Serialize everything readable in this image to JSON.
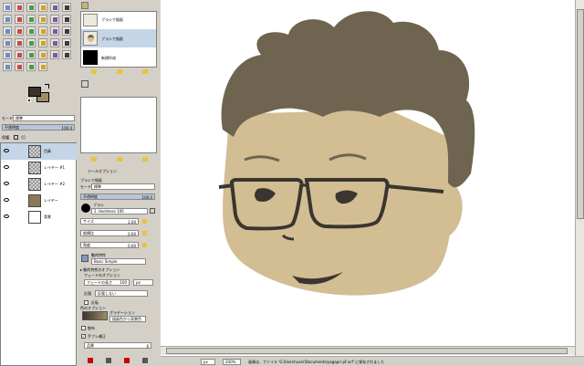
{
  "colors": {
    "hair": "#6f6450",
    "skin": "#d3bd93",
    "face_lines": "#3a352e",
    "canvas_bg": "#ffffff",
    "panel_bg": "#d4d0c8",
    "selection": "#c5d5e8",
    "fg_color": "#3b3228",
    "bg_color": "#9d8d66"
  },
  "toolbox": {
    "icons": [
      "rect-select-icon",
      "ellipse-select-icon",
      "lasso-icon",
      "fuzzy-select-icon",
      "color-select-icon",
      "scissors-icon",
      "foreground-select-icon",
      "paths-icon",
      "color-picker-icon",
      "zoom-icon",
      "measure-icon",
      "move-icon",
      "align-icon",
      "crop-icon",
      "rotate-icon",
      "scale-icon",
      "shear-icon",
      "perspective-icon",
      "flip-icon",
      "cage-icon",
      "text-icon",
      "bucket-fill-icon",
      "blend-icon",
      "pencil-icon",
      "paintbrush-icon",
      "eraser-icon",
      "airbrush-icon",
      "ink-icon",
      "clone-icon",
      "heal-icon",
      "perspective-clone-icon",
      "blur-icon",
      "smudge-icon",
      "dodge-icon"
    ]
  },
  "layers_panel": {
    "mode_label": "モード",
    "mode_value": "標準",
    "opacity_label": "不透明度",
    "opacity_value": "100.0",
    "lock_label": "保護",
    "layers": [
      {
        "name": "目鼻"
      },
      {
        "name": "レイヤー #1"
      },
      {
        "name": "レイヤー #2"
      },
      {
        "name": "レイヤー"
      },
      {
        "name": "背景"
      }
    ]
  },
  "brushes_panel": {
    "items": [
      {
        "label": "ブラシで描画"
      },
      {
        "label": "ブラシで描画"
      },
      {
        "label": "新規作成"
      }
    ]
  },
  "tool_options": {
    "tab_label": "ツールオプション",
    "title": "ブラシで描画",
    "mode_label": "モード",
    "mode_value": "標準",
    "opacity_label": "不透明度",
    "opacity_value": "100.0",
    "brush_label": "ブラシ",
    "brush_value": "2. Hardness 100",
    "size_label": "サイズ",
    "size_value": "2.00",
    "aspect_label": "縦横比",
    "aspect_value": "0.00",
    "angle_label": "角度",
    "angle_value": "0.00",
    "dynamics_label": "動的特性",
    "dynamics_value": "Basic Simple",
    "dynamics_options_label": "動的特性のオプション",
    "fade_label": "フェードのオプション",
    "fade_length_label": "フェードの長さ",
    "fade_length_value": "100",
    "fade_unit": "px",
    "repeat_label": "反復",
    "repeat_value": "反復しない",
    "reverse_label": "反転",
    "color_options_label": "色のオプション",
    "gradient_label": "グラデーション",
    "gradient_value": "描画色から背景色",
    "jitter_label": "散布",
    "smooth_label": "手ブレ補正",
    "quality_label": "品質",
    "quality_value": "6"
  },
  "statusbar": {
    "unit": "px",
    "zoom": "200%",
    "message": "画像は、ファイル 'G:\\Users\\user\\Documents\\yagapri-pF.xcf' に保存されました"
  },
  "canvas": {
    "description_free": ""
  }
}
